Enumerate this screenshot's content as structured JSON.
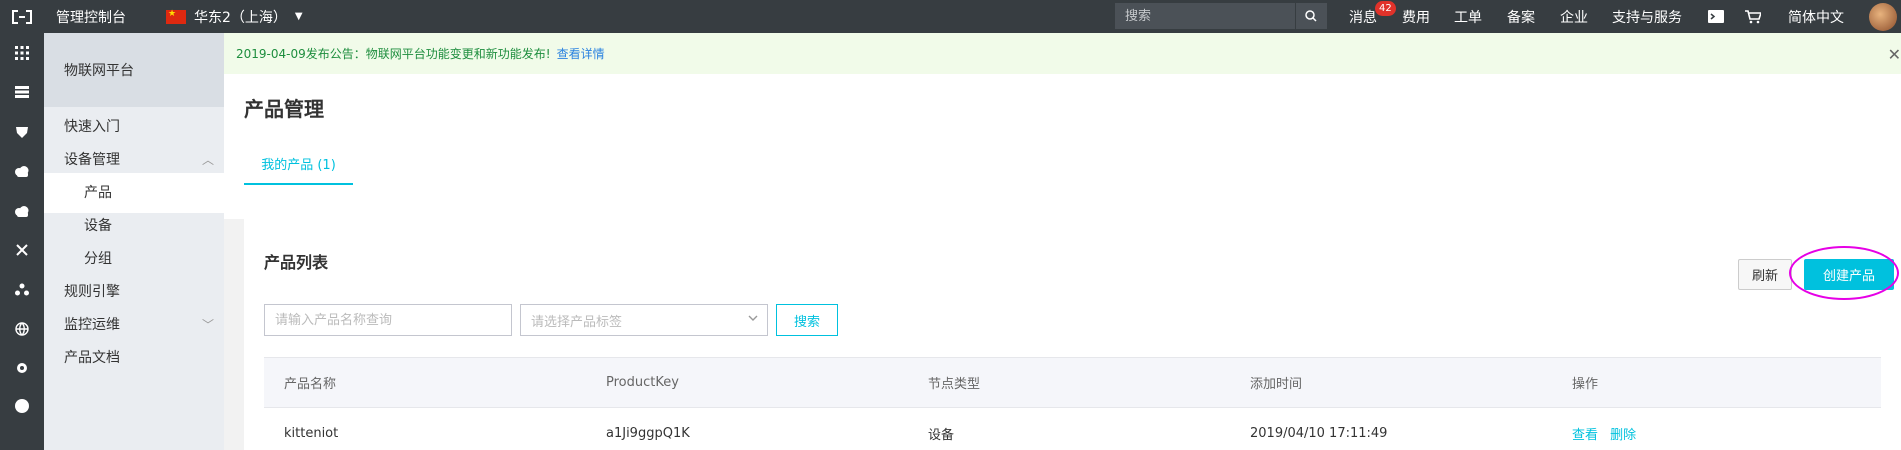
{
  "header": {
    "console_title": "管理控制台",
    "region": "华东2（上海）",
    "search_placeholder": "搜索",
    "messages_label": "消息",
    "messages_badge": "42",
    "nav": [
      "费用",
      "工单",
      "备案",
      "企业",
      "支持与服务"
    ],
    "language": "简体中文"
  },
  "sidebar": {
    "title": "物联网平台",
    "items": [
      {
        "label": "快速入门"
      },
      {
        "label": "设备管理"
      },
      {
        "label": "产品"
      },
      {
        "label": "设备"
      },
      {
        "label": "分组"
      },
      {
        "label": "规则引擎"
      },
      {
        "label": "监控运维"
      },
      {
        "label": "产品文档"
      }
    ]
  },
  "notice": {
    "text": "2019-04-09发布公告：物联网平台功能变更和新功能发布!",
    "link": "查看详情"
  },
  "page": {
    "title": "产品管理",
    "tab": "我的产品 (1)"
  },
  "card": {
    "title": "产品列表",
    "refresh": "刷新",
    "create": "创建产品",
    "name_placeholder": "请输入产品名称查询",
    "tag_placeholder": "请选择产品标签",
    "search": "搜索"
  },
  "table": {
    "columns": [
      "产品名称",
      "ProductKey",
      "节点类型",
      "添加时间",
      "操作"
    ],
    "rows": [
      {
        "name": "kitteniot",
        "key": "a1Ji9ggpQ1K",
        "node_type": "设备",
        "time": "2019/04/10 17:11:49",
        "view": "查看",
        "delete": "删除"
      }
    ]
  },
  "colors": {
    "accent": "#00c1de",
    "topbar": "#373d41",
    "highlight": "#e600e6"
  }
}
